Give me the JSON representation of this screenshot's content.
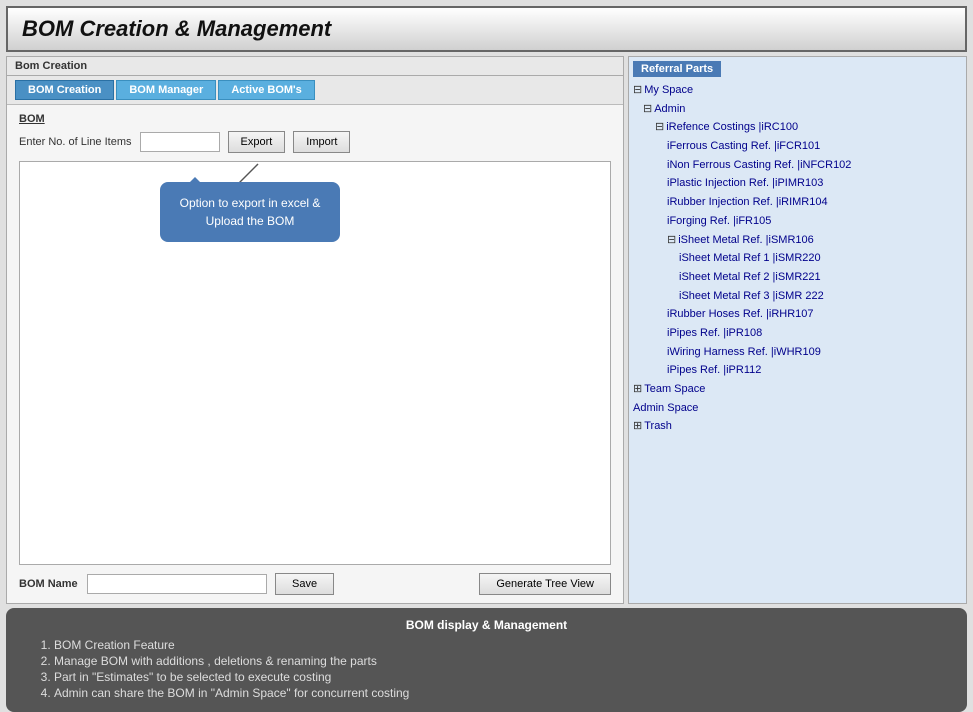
{
  "title": "BOM Creation & Management",
  "left_panel": {
    "panel_title": "Bom Creation",
    "tabs": [
      {
        "label": "BOM Creation",
        "active": true
      },
      {
        "label": "BOM Manager",
        "active": false
      },
      {
        "label": "Active BOM's",
        "active": false
      }
    ],
    "bom_section_label": "BOM",
    "line_items_label": "Enter No. of Line Items",
    "line_items_value": "",
    "export_label": "Export",
    "import_label": "Import",
    "tooltip_text": "Option to export in excel & Upload the BOM",
    "bom_name_label": "BOM Name",
    "bom_name_value": "",
    "save_label": "Save",
    "generate_label": "Generate Tree View"
  },
  "right_panel": {
    "header": "Referral Parts",
    "tree": [
      {
        "level": 0,
        "toggle": "⊟",
        "label": "My Space"
      },
      {
        "level": 1,
        "toggle": "⊟",
        "label": "Admin"
      },
      {
        "level": 2,
        "toggle": "⊟",
        "label": "iRefence Costings |iRC100"
      },
      {
        "level": 3,
        "toggle": "",
        "label": "iFerrous Casting Ref. |iFCR101"
      },
      {
        "level": 3,
        "toggle": "",
        "label": "iNon Ferrous Casting Ref.  |iNFCR102"
      },
      {
        "level": 3,
        "toggle": "",
        "label": "iPlastic Injection Ref. |iPIMR103"
      },
      {
        "level": 3,
        "toggle": "",
        "label": "iRubber Injection Ref. |iRIMR104"
      },
      {
        "level": 3,
        "toggle": "",
        "label": "iForging Ref. |iFR105"
      },
      {
        "level": 3,
        "toggle": "⊟",
        "label": "iSheet Metal Ref. |iSMR106"
      },
      {
        "level": 4,
        "toggle": "",
        "label": "iSheet Metal Ref 1 |iSMR220"
      },
      {
        "level": 4,
        "toggle": "",
        "label": "iSheet Metal Ref 2 |iSMR221"
      },
      {
        "level": 4,
        "toggle": "",
        "label": "iSheet Metal Ref 3 |iSMR 222"
      },
      {
        "level": 3,
        "toggle": "",
        "label": "iRubber Hoses Ref. |iRHR107"
      },
      {
        "level": 3,
        "toggle": "",
        "label": "iPipes Ref. |iPR108"
      },
      {
        "level": 3,
        "toggle": "",
        "label": "iWiring Harness Ref. |iWHR109"
      },
      {
        "level": 3,
        "toggle": "",
        "label": "iPipes Ref. |iPR112"
      },
      {
        "level": 0,
        "toggle": "⊞",
        "label": "Team Space"
      },
      {
        "level": 0,
        "toggle": "",
        "label": "Admin Space"
      },
      {
        "level": 0,
        "toggle": "⊞",
        "label": "Trash"
      }
    ]
  },
  "bottom_panel": {
    "heading": "BOM display & Management",
    "items": [
      "BOM Creation Feature",
      "Manage BOM with additions , deletions & renaming the parts",
      "Part in \"Estimates\" to be selected  to execute costing",
      "Admin can share the BOM in \"Admin Space\" for concurrent costing"
    ]
  }
}
